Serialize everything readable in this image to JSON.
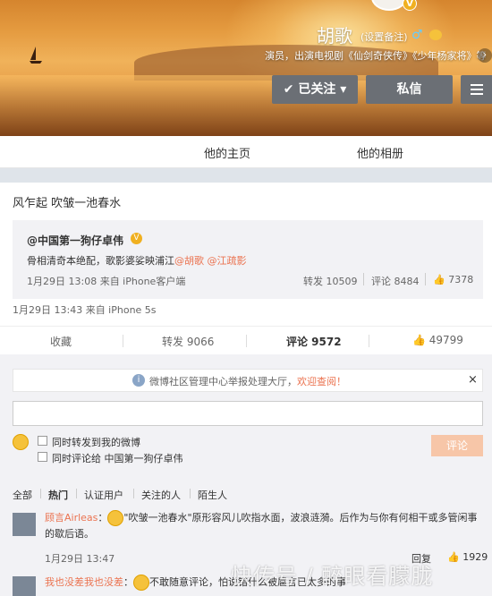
{
  "profile": {
    "name": "胡歌",
    "remark": "(设置备注)",
    "gender": "♂",
    "description": "演员，出演电视剧《仙剑奇侠传》《少年杨家将》等",
    "follow_btn": "已关注",
    "message_btn": "私信"
  },
  "tabs": [
    "他的主页",
    "他的相册"
  ],
  "post": {
    "text": "风乍起 吹皱一池春水",
    "repost": {
      "user": "@中国第一狗仔卓伟",
      "text": "骨相清奇本绝配，歌影婆娑映浦江",
      "mention1": "@胡歌",
      "mention2": "@江疏影",
      "time": "1月29日 13:08 来自 iPhone客户端",
      "forward": "转发 10509",
      "comment": "评论 8484",
      "likes": "7378"
    },
    "time": "1月29日 13:43 来自 iPhone 5s"
  },
  "actions": {
    "favorite": "收藏",
    "forward": "转发 9066",
    "comment": "评论 9572",
    "like": "49799"
  },
  "notice": {
    "text": "微博社区管理中心举报处理大厅，",
    "link": "欢迎查阅！",
    "close": "×"
  },
  "composer": {
    "opt1": "同时转发到我的微博",
    "opt2": "同时评论给 中国第一狗仔卓伟",
    "submit": "评论"
  },
  "filters": [
    "全部",
    "热门",
    "认证用户",
    "关注的人",
    "陌生人"
  ],
  "comments": [
    {
      "user": "顾言Airleas",
      "text": "\"吹皱一池春水\"原形容风儿吹指水面，波浪涟漪。后作为与你有何相干或多管闲事的歇后语。",
      "time": "1月29日 13:47",
      "reply": "回复",
      "likes": "1929"
    },
    {
      "user": "我也没差我也没差",
      "text": "不敢随意评论，怕说错什么被扈言已太多的事",
      "time": "",
      "reply": "",
      "likes": ""
    }
  ],
  "watermark": "快传号 / 醉眼看朦胧"
}
